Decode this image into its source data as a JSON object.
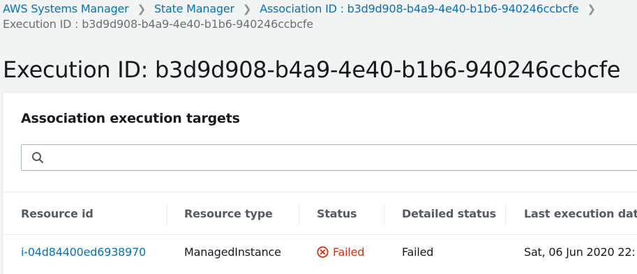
{
  "breadcrumb": {
    "items": [
      {
        "label": "AWS Systems Manager"
      },
      {
        "label": "State Manager"
      },
      {
        "label": "Association ID : b3d9d908-b4a9-4e40-b1b6-940246ccbcfe"
      }
    ],
    "current": "Execution ID : b3d9d908-b4a9-4e40-b1b6-940246ccbcfe"
  },
  "page": {
    "title": "Execution ID: b3d9d908-b4a9-4e40-b1b6-940246ccbcfe"
  },
  "targets_panel": {
    "title": "Association execution targets",
    "search": {
      "value": "",
      "placeholder": ""
    },
    "columns": [
      "Resource id",
      "Resource type",
      "Status",
      "Detailed status",
      "Last execution date"
    ],
    "rows": [
      {
        "resource_id": "i-04d84400ed6938970",
        "resource_type": "ManagedInstance",
        "status": "Failed",
        "detailed_status": "Failed",
        "last_execution_date": "Sat, 06 Jun 2020 22:"
      }
    ]
  },
  "colors": {
    "link": "#0073bb",
    "failed": "#d13212",
    "text": "#16191f",
    "header_text": "#545b64",
    "background": "#f2f3f3"
  },
  "icons": {
    "search": "search-icon",
    "status_failed": "error-circle-icon",
    "separator": "chevron-right-icon"
  }
}
